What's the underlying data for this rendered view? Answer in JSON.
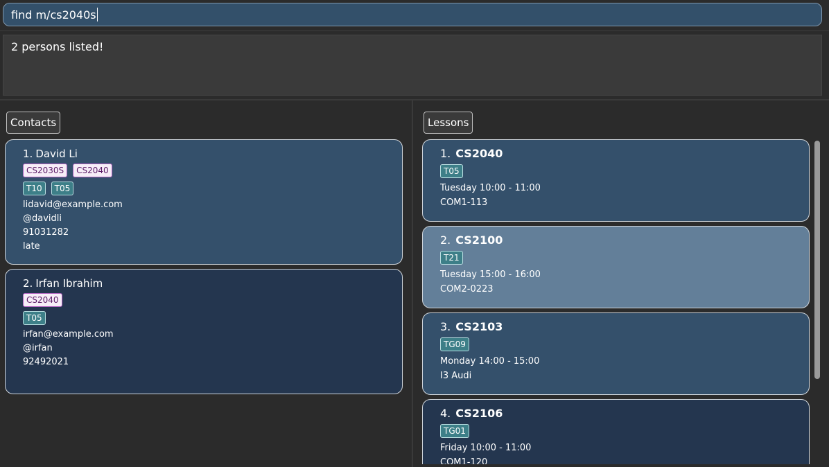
{
  "command": {
    "value": "find m/cs2040s"
  },
  "result": {
    "message": "2 persons listed!"
  },
  "contacts": {
    "label": "Contacts",
    "items": [
      {
        "index": "1.",
        "name": "David Li",
        "module_tags": [
          "CS2030S",
          "CS2040"
        ],
        "tutorial_tags": [
          "T10",
          "T05"
        ],
        "email": "lidavid@example.com",
        "telegram": "@davidli",
        "phone": "91031282",
        "remark": "late"
      },
      {
        "index": "2.",
        "name": "Irfan Ibrahim",
        "module_tags": [
          "CS2040"
        ],
        "tutorial_tags": [
          "T05"
        ],
        "email": "irfan@example.com",
        "telegram": "@irfan",
        "phone": "92492021"
      }
    ]
  },
  "lessons": {
    "label": "Lessons",
    "selected_index": 1,
    "items": [
      {
        "index": "1.",
        "code": "CS2040",
        "tag": "T05",
        "day": "Tuesday",
        "time": "10:00 - 11:00",
        "venue": "COM1-113"
      },
      {
        "index": "2.",
        "code": "CS2100",
        "tag": "T21",
        "day": "Tuesday",
        "time": "15:00 - 16:00",
        "venue": "COM2-0223"
      },
      {
        "index": "3.",
        "code": "CS2103",
        "tag": "TG09",
        "day": "Monday",
        "time": "14:00 - 15:00",
        "venue": "I3 Audi"
      },
      {
        "index": "4.",
        "code": "CS2106",
        "tag": "TG01",
        "day": "Friday",
        "time": "10:00 - 11:00",
        "venue": "COM1-120"
      }
    ]
  }
}
